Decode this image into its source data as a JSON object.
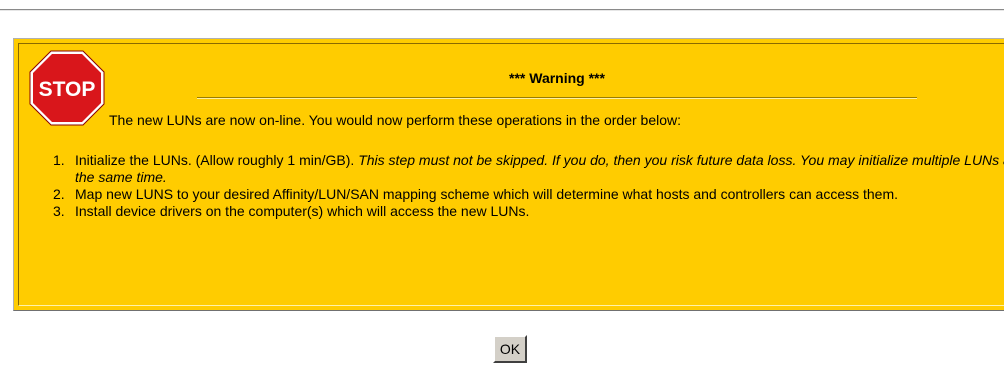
{
  "dialog": {
    "title": "*** Warning ***",
    "stop_sign_text": "STOP",
    "intro": "The new LUNs are now on-line. You would now perform these operations in the order below:",
    "steps": [
      {
        "number": "1.",
        "text": "Initialize the LUNs. (Allow roughly 1 min/GB). ",
        "emphasis": "This step must not be skipped. If you do, then you risk future data loss. You may initialize multiple LUNs at the same time."
      },
      {
        "number": "2.",
        "text": "Map new LUNS to your desired Affinity/LUN/SAN mapping scheme which will determine what hosts and controllers can access them.",
        "emphasis": ""
      },
      {
        "number": "3.",
        "text": "Install device drivers on the computer(s) which will access the new LUNs.",
        "emphasis": ""
      }
    ],
    "ok_label": "OK"
  },
  "colors": {
    "panel_background": "#ffcc00",
    "stop_red": "#d9161b",
    "button_face": "#d4d0c8"
  },
  "icons": {
    "stop": "stop-sign-icon"
  }
}
